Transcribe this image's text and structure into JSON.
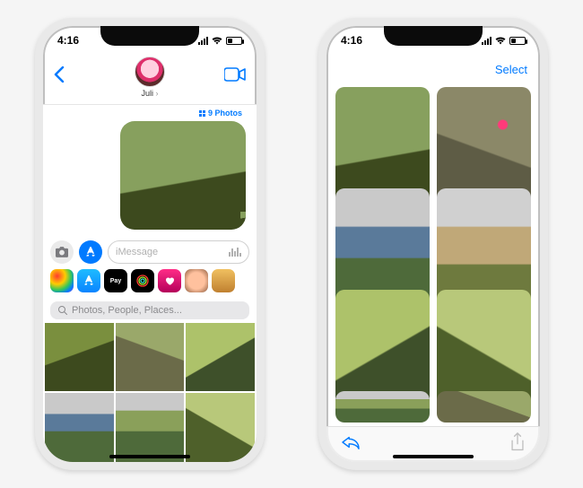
{
  "status": {
    "time": "4:16"
  },
  "left": {
    "contact_name": "Juli",
    "photos_count_label": "9 Photos",
    "input_placeholder": "iMessage",
    "search_placeholder": "Photos, People, Places..."
  },
  "right": {
    "select_label": "Select"
  }
}
